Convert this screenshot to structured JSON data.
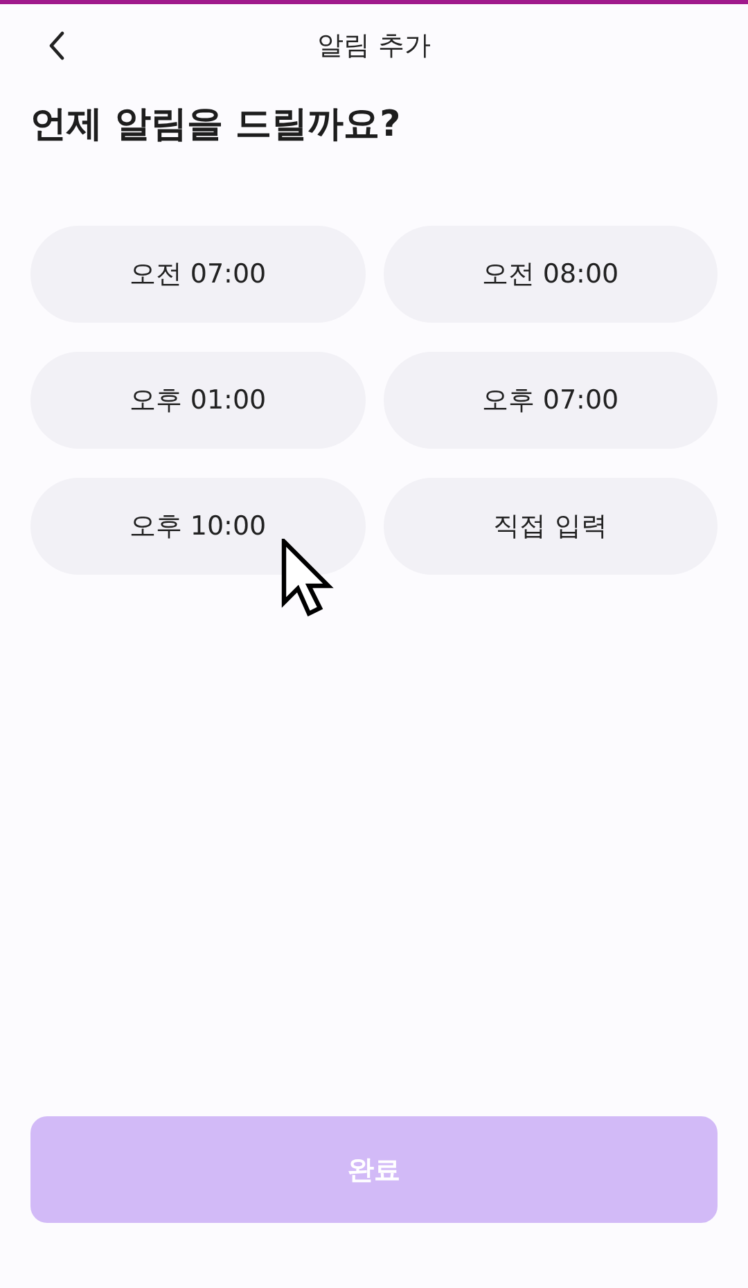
{
  "header": {
    "title": "알림 추가"
  },
  "question": "언제 알림을 드릴까요?",
  "options": [
    {
      "label": "오전 07:00",
      "selected": false
    },
    {
      "label": "오전 08:00",
      "selected": false
    },
    {
      "label": "오후 01:00",
      "selected": false
    },
    {
      "label": "오후 07:00",
      "selected": false
    },
    {
      "label": "오후 10:00",
      "selected": false
    },
    {
      "label": "직접 입력",
      "selected": false
    }
  ],
  "done_button": {
    "label": "완료",
    "disabled": true
  }
}
